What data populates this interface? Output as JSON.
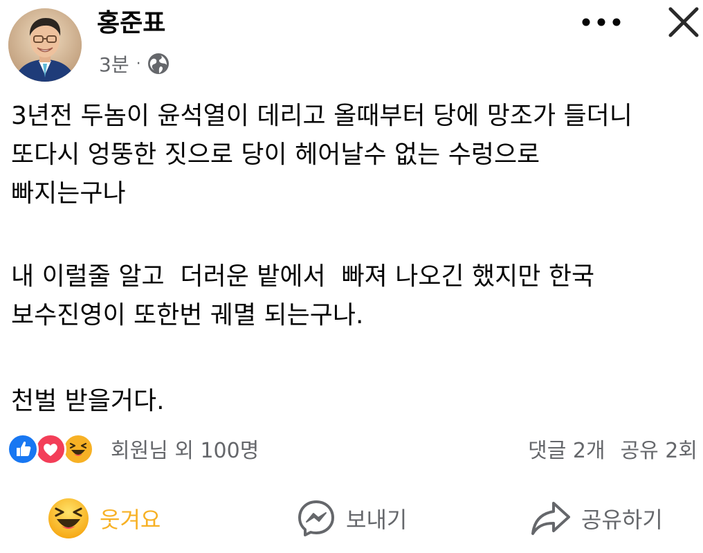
{
  "post": {
    "author": "홍준표",
    "time": "3분",
    "separator": "·",
    "audience_icon": "globe-icon",
    "lines_p1": [
      "3년전 두놈이 윤석열이 데리고 올때부터 당에 망조가 들더니",
      "또다시 엉뚱한 짓으로 당이 헤어날수 없는 수렁으로",
      "빠지는구나"
    ],
    "lines_p2": [
      "내 이럴줄 알고  더러운 밭에서  빠져 나오긴 했지만 한국",
      "보수진영이 또한번 궤멸 되는구나."
    ],
    "lines_p3": [
      "천벌 받을거다."
    ]
  },
  "header": {
    "more_icon": "more-horizontal-icon",
    "close_icon": "close-icon"
  },
  "reactions": {
    "icons": [
      "like-icon",
      "love-icon",
      "haha-icon"
    ],
    "summary": "회원님 외 100명",
    "comments": "댓글 2개",
    "shares": "공유 2회"
  },
  "actions": {
    "laugh_label": "웃겨요",
    "send_label": "보내기",
    "share_label": "공유하기"
  },
  "colors": {
    "like": "#1877f2",
    "love": "#f33e58",
    "haha": "#f7b125",
    "secondary_text": "#65676b"
  }
}
